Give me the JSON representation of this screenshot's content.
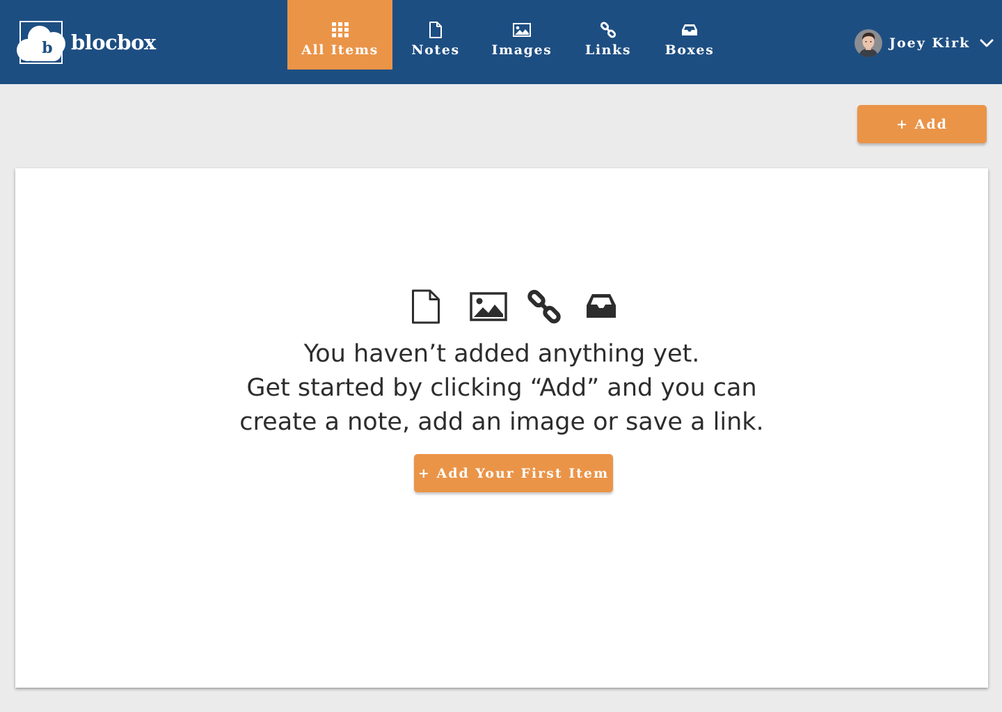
{
  "app": {
    "name": "blocbox",
    "logo_letter": "b"
  },
  "nav": {
    "items": [
      {
        "label": "All Items",
        "icon": "grid-icon",
        "active": true
      },
      {
        "label": "Notes",
        "icon": "file-icon",
        "active": false
      },
      {
        "label": "Images",
        "icon": "image-icon",
        "active": false
      },
      {
        "label": "Links",
        "icon": "link-icon",
        "active": false
      },
      {
        "label": "Boxes",
        "icon": "inbox-icon",
        "active": false
      }
    ]
  },
  "user": {
    "name": "Joey Kirk",
    "menu_icon": "chevron-down-icon"
  },
  "toolbar": {
    "add_label": "+ Add"
  },
  "empty_state": {
    "icons": [
      "file-icon",
      "image-icon",
      "link-icon",
      "inbox-icon"
    ],
    "lines": [
      "You haven’t added anything yet.",
      "Get started by clicking “Add” and you can",
      "create a note, add an image or save a link."
    ],
    "cta_label": "+ Add Your First Item"
  },
  "colors": {
    "header": "#1d4e82",
    "accent": "#ea9448",
    "background": "#ebebeb",
    "panel": "#ffffff",
    "text": "#2d2d2d"
  }
}
